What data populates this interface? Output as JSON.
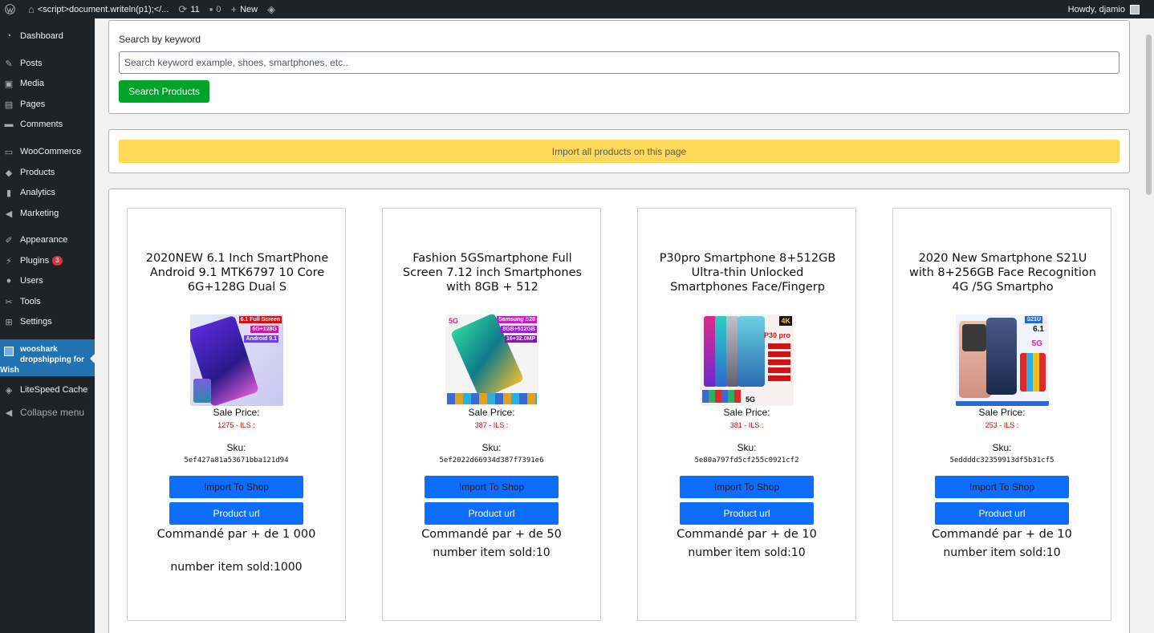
{
  "adminbar": {
    "site_title": "<script>document.writeln(p1);</...",
    "updates_count": "11",
    "comments_count": "0",
    "new_label": "New",
    "howdy": "Howdy, djamio"
  },
  "sidebar": {
    "items": [
      {
        "label": "Dashboard",
        "icon": "dashboard-icon"
      },
      {
        "label": "Posts",
        "icon": "pin-icon"
      },
      {
        "label": "Media",
        "icon": "media-icon"
      },
      {
        "label": "Pages",
        "icon": "pages-icon"
      },
      {
        "label": "Comments",
        "icon": "comment-icon"
      },
      {
        "label": "WooCommerce",
        "icon": "woo-icon"
      },
      {
        "label": "Products",
        "icon": "box-icon"
      },
      {
        "label": "Analytics",
        "icon": "bar-chart-icon"
      },
      {
        "label": "Marketing",
        "icon": "megaphone-icon"
      },
      {
        "label": "Appearance",
        "icon": "brush-icon"
      },
      {
        "label": "Plugins",
        "icon": "plug-icon",
        "badge": "3"
      },
      {
        "label": "Users",
        "icon": "user-icon"
      },
      {
        "label": "Tools",
        "icon": "wrench-icon"
      },
      {
        "label": "Settings",
        "icon": "settings-icon"
      }
    ],
    "active_line1": "wooshark",
    "active_line2": "dropshipping for",
    "active_line3": "Wish",
    "litespeed": "LiteSpeed Cache",
    "collapse": "Collapse menu"
  },
  "search": {
    "label": "Search by keyword",
    "placeholder": "Search keyword example, shoes, smartphones, etc..",
    "button": "Search Products"
  },
  "import_all": "Import all products on this page",
  "labels": {
    "sale_price": "Sale Price:",
    "sku": "Sku:",
    "import_btn": "Import To Shop",
    "url_btn": "Product url"
  },
  "products": [
    {
      "title": "2020NEW 6.1 Inch SmartPhone Android 9.1 MTK6797 10 Core 6G+128G Dual S",
      "price": "1275 - ILS :",
      "sku": "5ef427a81a53671bba121d94",
      "ordered": "Commandé par + de 1 000",
      "sold": "number item sold:1000",
      "image_tags": [
        "6.1 Full Screen",
        "6G+128G",
        "Android 9.1"
      ]
    },
    {
      "title": "Fashion 5GSmartphone Full Screen 7.12 inch Smartphones with 8GB + 512",
      "price": "387 - ILS :",
      "sku": "5ef2022d66934d387f7391e6",
      "ordered": "Commandé par + de 50",
      "sold": "number item sold:10",
      "image_tags": [
        "Samsung S20",
        "8GB+512GB",
        "16+32.0MP",
        "5G"
      ]
    },
    {
      "title": "P30pro Smartphone 8+512GB Ultra-thin Unlocked Smartphones Face/Fingerp",
      "price": "381 - ILS :",
      "sku": "5e80a797fd5cf255c0921cf2",
      "ordered": "Commandé par + de 10",
      "sold": "number item sold:10",
      "image_tags": [
        "4K",
        "P30 pro",
        "5G"
      ]
    },
    {
      "title": "2020 New Smartphone S21U with 8+256GB Face Recognition 4G /5G Smartpho",
      "price": "253 - ILS :",
      "sku": "5eddddc32359913df5b31cf5",
      "ordered": "Commandé par + de 10",
      "sold": "number item sold:10",
      "image_tags": [
        "S21U",
        "6.1",
        "5G"
      ]
    }
  ]
}
